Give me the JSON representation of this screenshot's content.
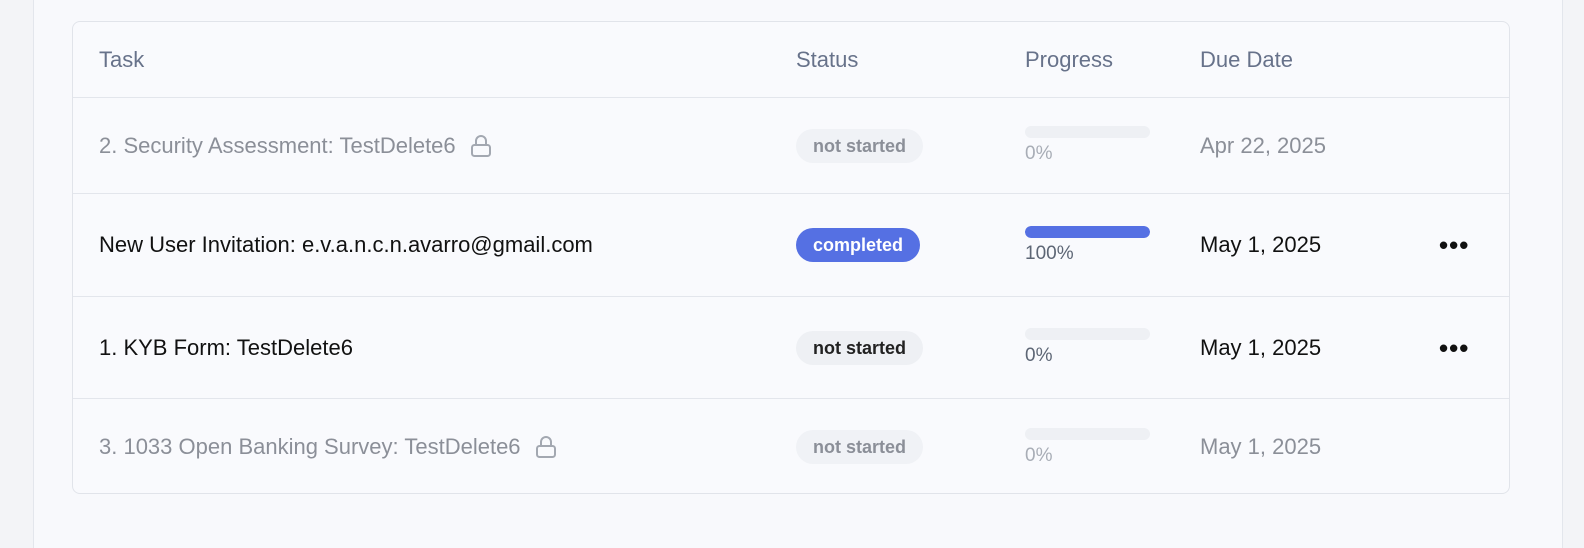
{
  "columns": {
    "task": "Task",
    "status": "Status",
    "progress": "Progress",
    "due": "Due Date"
  },
  "rows": [
    {
      "task": "2. Security Assessment: TestDelete6",
      "locked": true,
      "status": "not started",
      "progress_value": 0,
      "progress_label": "0%",
      "due": "Apr 22, 2025"
    },
    {
      "task": "New User Invitation: e.v.a.n.c.n.avarro@gmail.com",
      "locked": false,
      "status": "completed",
      "progress_value": 100,
      "progress_label": "100%",
      "due": "May 1, 2025",
      "actions_icon": "more-horizontal-icon"
    },
    {
      "task": "1. KYB Form: TestDelete6",
      "locked": false,
      "status": "not started",
      "progress_value": 0,
      "progress_label": "0%",
      "due": "May 1, 2025",
      "actions_icon": "more-horizontal-icon"
    },
    {
      "task": "3. 1033 Open Banking Survey: TestDelete6",
      "locked": true,
      "status": "not started",
      "progress_value": 0,
      "progress_label": "0%",
      "due": "May 1, 2025"
    }
  ],
  "colors": {
    "accent": "#5570e3",
    "muted_text": "#8b8f98",
    "header_text": "#67728a"
  },
  "icons": {
    "lock": "lock-icon",
    "more": "more-horizontal-icon"
  }
}
